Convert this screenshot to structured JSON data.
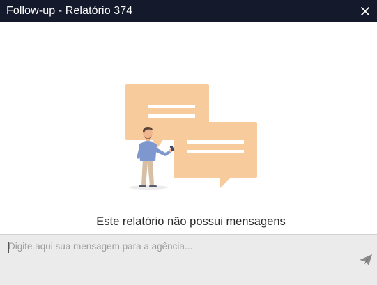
{
  "window": {
    "title": "Follow-up - Relatório 374",
    "close_icon": "close-icon"
  },
  "empty_state": {
    "illustration": "chat-illustration",
    "message": "Este relatório não possui mensagens"
  },
  "composer": {
    "placeholder": "Digite aqui sua mensagem para a agência...",
    "value": "",
    "send_icon": "send-icon"
  },
  "colors": {
    "titlebar": "#141a2b",
    "bubble": "#f7cb9c",
    "composer_bg": "#ebebeb",
    "person_shirt": "#7e98cf",
    "person_pants": "#d6bfa5"
  }
}
